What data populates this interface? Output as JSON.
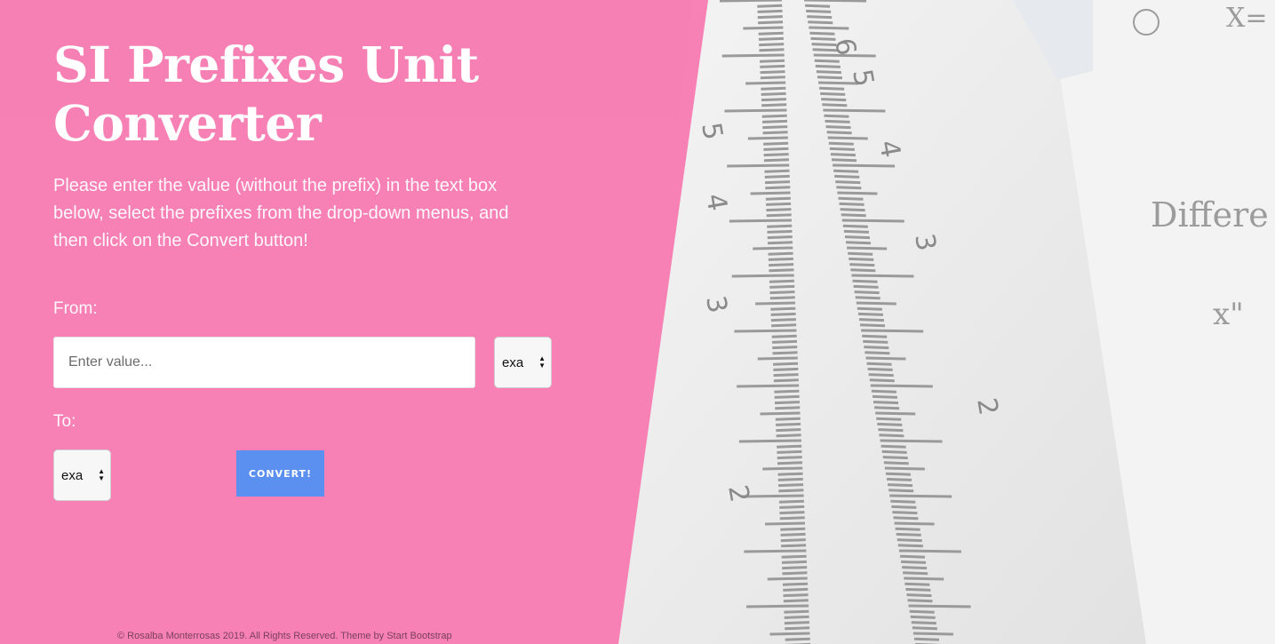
{
  "masthead": {
    "title": "SI Prefixes Unit Converter",
    "intro": "Please enter the value (without the prefix) in the text box below, select the prefixes from the drop-down menus, and then click on the Convert button!"
  },
  "form": {
    "from_label": "From:",
    "value_placeholder": "Enter value...",
    "from_prefix": "exa",
    "to_label": "To:",
    "to_prefix": "exa",
    "convert_label": "CONVERT!"
  },
  "footer": {
    "text": "© Rosalba Monterrosas 2019. All Rights Reserved. Theme by Start Bootstrap"
  },
  "colors": {
    "panel_pink": "#f778b0",
    "button_blue": "#5b8ff0"
  }
}
